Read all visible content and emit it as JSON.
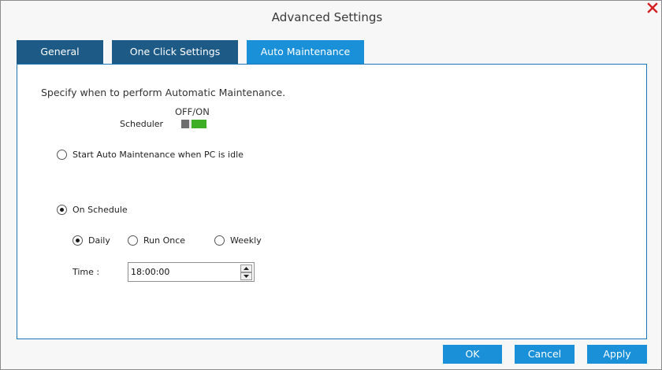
{
  "window": {
    "title": "Advanced Settings"
  },
  "tabs": [
    {
      "label": "General",
      "active": false
    },
    {
      "label": "One Click Settings",
      "active": false
    },
    {
      "label": "Auto Maintenance",
      "active": true
    }
  ],
  "auto_maintenance": {
    "description": "Specify when to perform Automatic Maintenance.",
    "toggle_caption": "OFF/ON",
    "scheduler_label": "Scheduler",
    "scheduler_on": true,
    "mode_options": [
      {
        "label": "Start Auto Maintenance when PC is idle",
        "checked": false
      },
      {
        "label": "On Schedule",
        "checked": true
      }
    ],
    "frequency_options": [
      {
        "label": "Daily",
        "checked": true
      },
      {
        "label": "Run Once",
        "checked": false
      },
      {
        "label": "Weekly",
        "checked": false
      }
    ],
    "time_label": "Time :",
    "time_value": "18:00:00"
  },
  "buttons": {
    "ok": "OK",
    "cancel": "Cancel",
    "apply": "Apply"
  },
  "colors": {
    "tab_inactive": "#1e5a86",
    "tab_active": "#1990d8",
    "button": "#1990d8",
    "toggle_on": "#3fae27",
    "close_icon": "#d42020"
  },
  "icons": {
    "close": "close-icon",
    "spin_up": "spin-up-icon",
    "spin_down": "spin-down-icon"
  }
}
